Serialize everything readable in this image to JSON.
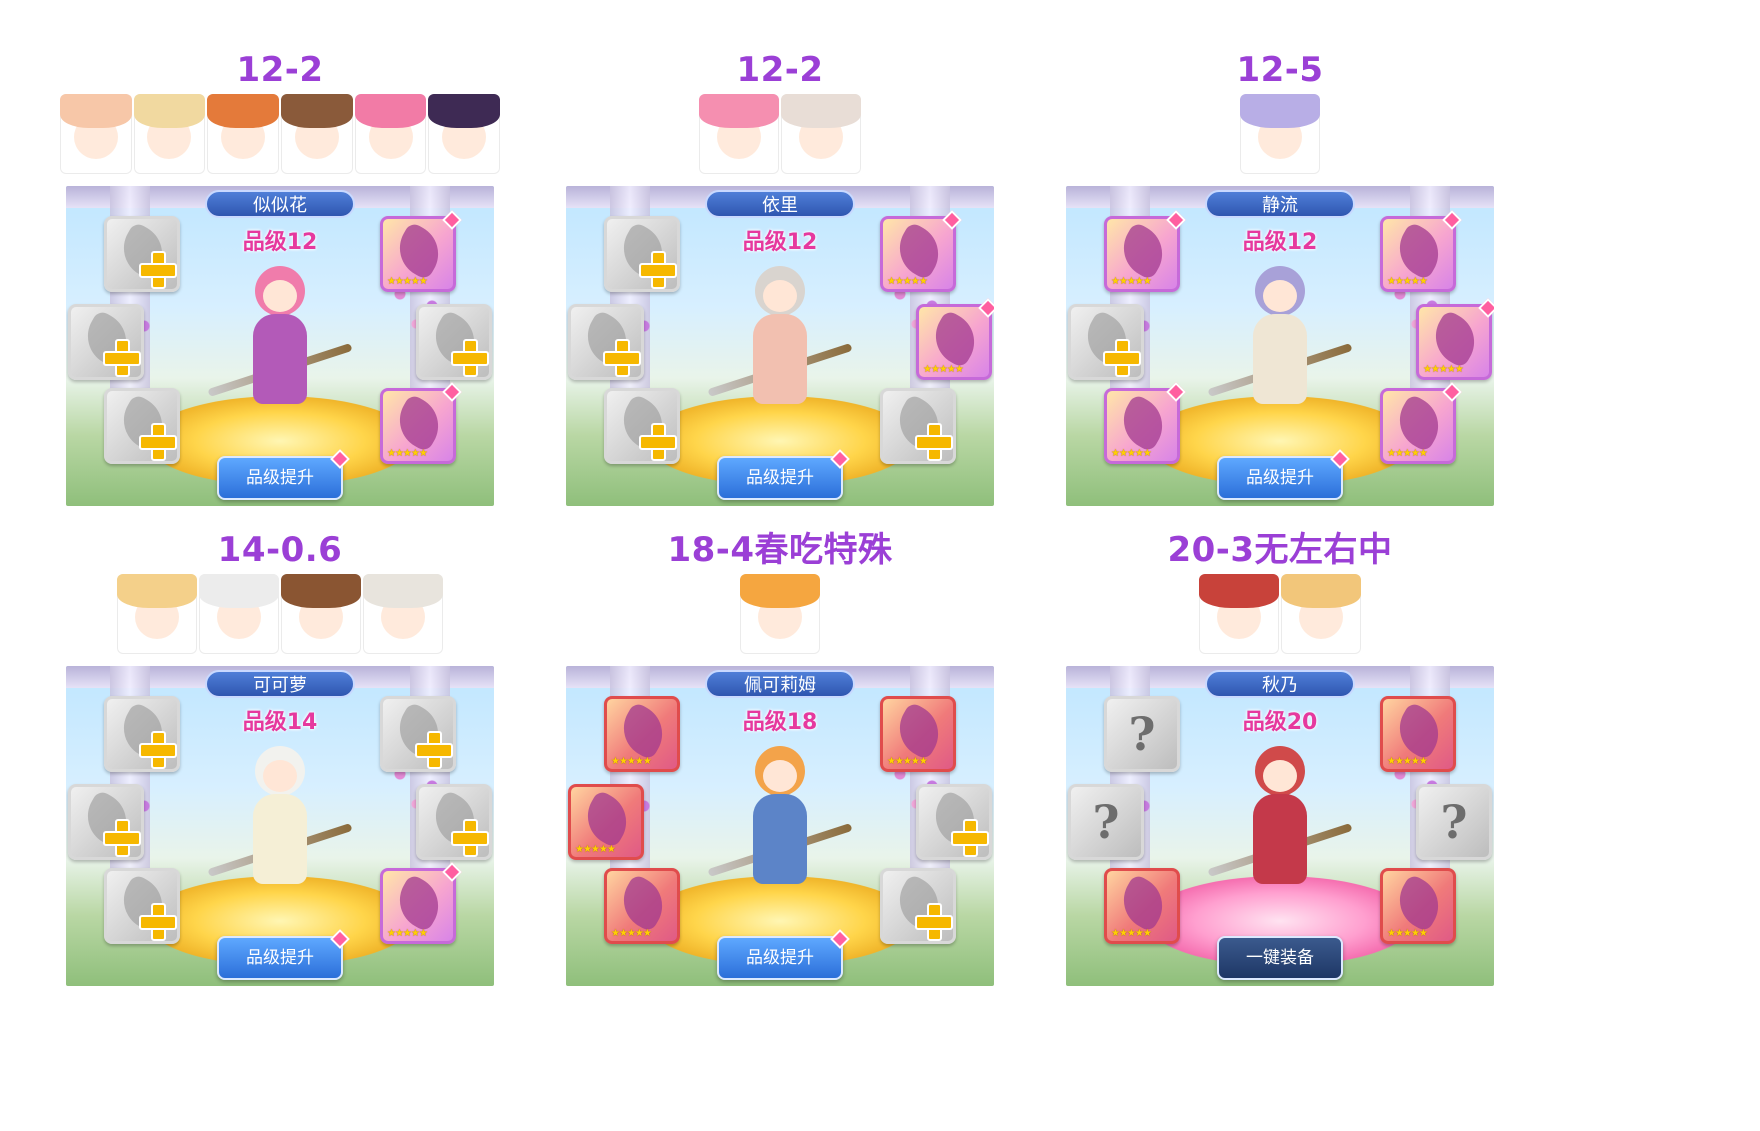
{
  "sections": [
    {
      "stage": "12-2",
      "character": "似似花",
      "grade": "品级12",
      "button": "品级提升",
      "colors": {
        "hair": "#f07cab",
        "cloth": "#b35ab8"
      },
      "portraits": [
        {
          "icon": "girl-portrait-icon",
          "hair": "#f7c7a8"
        },
        {
          "icon": "girl-portrait-icon",
          "hair": "#f1d9a0"
        },
        {
          "icon": "girl-portrait-icon",
          "hair": "#e47a3a"
        },
        {
          "icon": "girl-portrait-icon",
          "hair": "#8a5a3a"
        },
        {
          "icon": "girl-portrait-icon",
          "hair": "#f27ba6"
        },
        {
          "icon": "girl-portrait-icon",
          "hair": "#3e2a54"
        }
      ]
    },
    {
      "stage": "12-2",
      "character": "依里",
      "grade": "品级12",
      "button": "品级提升",
      "colors": {
        "hair": "#d9d4cf",
        "cloth": "#f2c0b0"
      },
      "portraits": [
        {
          "icon": "girl-portrait-icon",
          "hair": "#f58fb0"
        },
        {
          "icon": "girl-portrait-icon",
          "hair": "#e8ddd6"
        }
      ]
    },
    {
      "stage": "12-5",
      "character": "静流",
      "grade": "品级12",
      "button": "品级提升",
      "colors": {
        "hair": "#a8a1d8",
        "cloth": "#efe6d4"
      },
      "portraits": [
        {
          "icon": "girl-portrait-icon",
          "hair": "#b8aee6"
        }
      ]
    },
    {
      "stage": "14-0.6",
      "character": "可可萝",
      "grade": "品级14",
      "button": "品级提升",
      "colors": {
        "hair": "#f2f2ee",
        "cloth": "#f5efd6"
      },
      "portraits": [
        {
          "icon": "girl-portrait-icon",
          "hair": "#f4d08a"
        },
        {
          "icon": "girl-portrait-icon",
          "hair": "#ececec"
        },
        {
          "icon": "girl-portrait-icon",
          "hair": "#8a5532"
        },
        {
          "icon": "girl-portrait-icon",
          "hair": "#e8e4dd"
        }
      ]
    },
    {
      "stage": "18-4春吃特殊",
      "character": "佩可莉姆",
      "grade": "品级18",
      "button": "品级提升",
      "colors": {
        "hair": "#f3a34a",
        "cloth": "#5c84c8"
      },
      "portraits": [
        {
          "icon": "girl-portrait-icon",
          "hair": "#f5a640"
        }
      ]
    },
    {
      "stage": "20-3无左右中",
      "character": "秋乃",
      "grade": "品级20",
      "button": "一键装备",
      "colors": {
        "hair": "#d04a4a",
        "cloth": "#c4394a"
      },
      "portraits": [
        {
          "icon": "girl-portrait-icon",
          "hair": "#c8423a"
        },
        {
          "icon": "girl-portrait-icon",
          "hair": "#f2c67a"
        }
      ]
    }
  ]
}
